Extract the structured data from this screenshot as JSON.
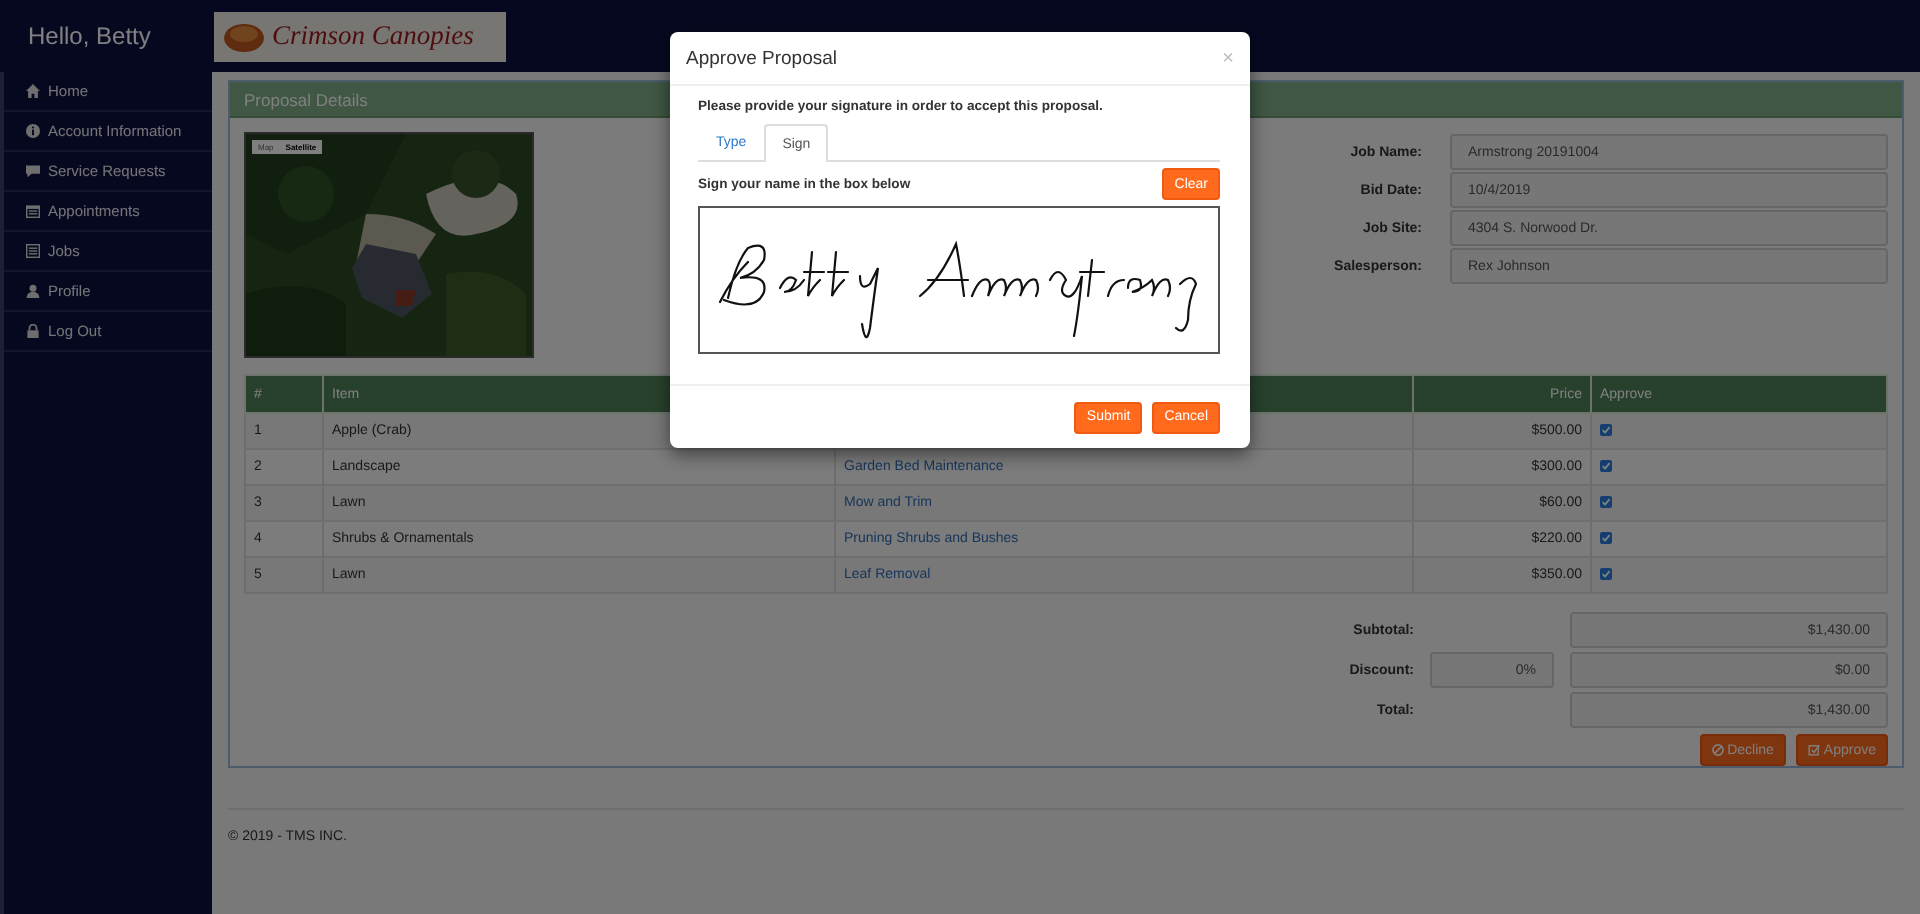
{
  "sidebar": {
    "greeting": "Hello, Betty",
    "items": [
      {
        "label": "Home"
      },
      {
        "label": "Account Information"
      },
      {
        "label": "Service Requests"
      },
      {
        "label": "Appointments"
      },
      {
        "label": "Jobs"
      },
      {
        "label": "Profile"
      },
      {
        "label": "Log Out"
      }
    ]
  },
  "logo": {
    "text": "Crimson Canopies"
  },
  "panel": {
    "title": "Proposal Details",
    "map": {
      "type_buttons": [
        {
          "label": "Map",
          "selected": false
        },
        {
          "label": "Satellite",
          "selected": true
        }
      ]
    },
    "fields": [
      {
        "label": "Job Name:",
        "value": "Armstrong 20191004"
      },
      {
        "label": "Bid Date:",
        "value": "10/4/2019"
      },
      {
        "label": "Job Site:",
        "value": "4304 S. Norwood Dr."
      },
      {
        "label": "Salesperson:",
        "value": "Rex Johnson"
      }
    ],
    "table": {
      "columns": [
        "#",
        "Item",
        "Price",
        "Approve"
      ],
      "rows": [
        {
          "number": "1",
          "item": "Apple (Crab)",
          "price": "$500.00",
          "approved": true
        },
        {
          "number": "2",
          "item": "Landscape",
          "service": "Garden Bed Maintenance",
          "price": "$300.00",
          "approved": true
        },
        {
          "number": "3",
          "item": "Lawn",
          "service": "Mow and Trim",
          "price": "$60.00",
          "approved": true
        },
        {
          "number": "4",
          "item": "Shrubs & Ornamentals",
          "service": "Pruning Shrubs and Bushes",
          "price": "$220.00",
          "approved": true
        },
        {
          "number": "5",
          "item": "Lawn",
          "service": "Leaf Removal",
          "price": "$350.00",
          "approved": true
        }
      ]
    },
    "totals": {
      "subtotal_label": "Subtotal:",
      "subtotal": "$1,430.00",
      "discount_label": "Discount:",
      "discount_percent": "0%",
      "discount": "$0.00",
      "total_label": "Total:",
      "total": "$1,430.00"
    },
    "buttons": {
      "decline": "Decline",
      "approve": "Approve"
    }
  },
  "footer": "© 2019 - TMS INC.",
  "modal": {
    "title": "Approve Proposal",
    "close": "×",
    "instruction": "Please provide your signature in order to accept this proposal.",
    "tabs": [
      {
        "label": "Type",
        "selected": false
      },
      {
        "label": "Sign",
        "selected": true
      }
    ],
    "sign_label": "Sign your name in the box below",
    "clear": "Clear",
    "submit": "Submit",
    "cancel": "Cancel"
  }
}
